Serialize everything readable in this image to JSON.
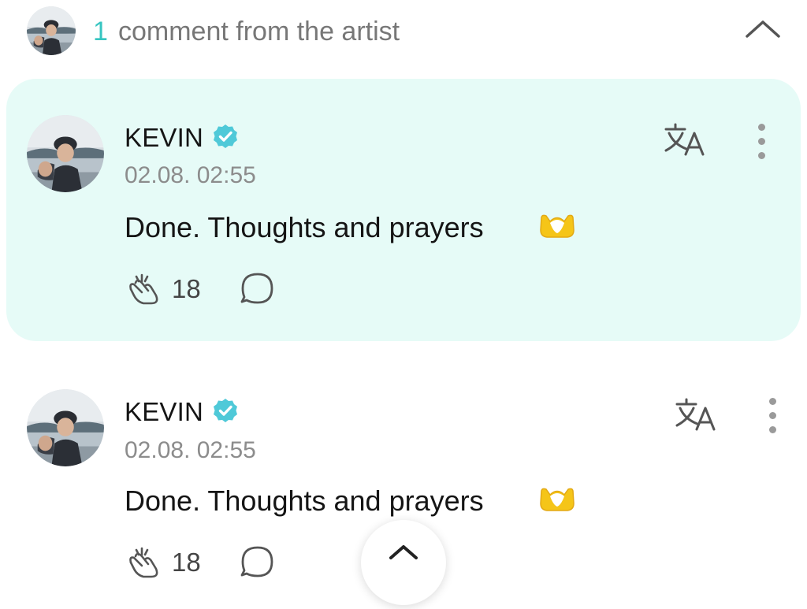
{
  "header": {
    "count": "1",
    "label": "comment from the artist",
    "collapse_icon": "chevron-up-icon"
  },
  "comments": [
    {
      "author": "KEVIN",
      "verified": true,
      "timestamp": "02.08. 02:55",
      "text": "Done. Thoughts and prayers",
      "emoji": "heart-hands-emoji",
      "likes": "18",
      "highlighted": true
    },
    {
      "author": "KEVIN",
      "verified": true,
      "timestamp": "02.08. 02:55",
      "text": "Done. Thoughts and prayers",
      "emoji": "heart-hands-emoji",
      "likes": "18",
      "highlighted": false
    }
  ],
  "colors": {
    "accent": "#37c5c1",
    "highlight_bg": "#e6fbf7",
    "verified_badge": "#4fc9d8",
    "heart_emoji": "#f5c518"
  },
  "scroll_top_icon": "chevron-up-icon"
}
